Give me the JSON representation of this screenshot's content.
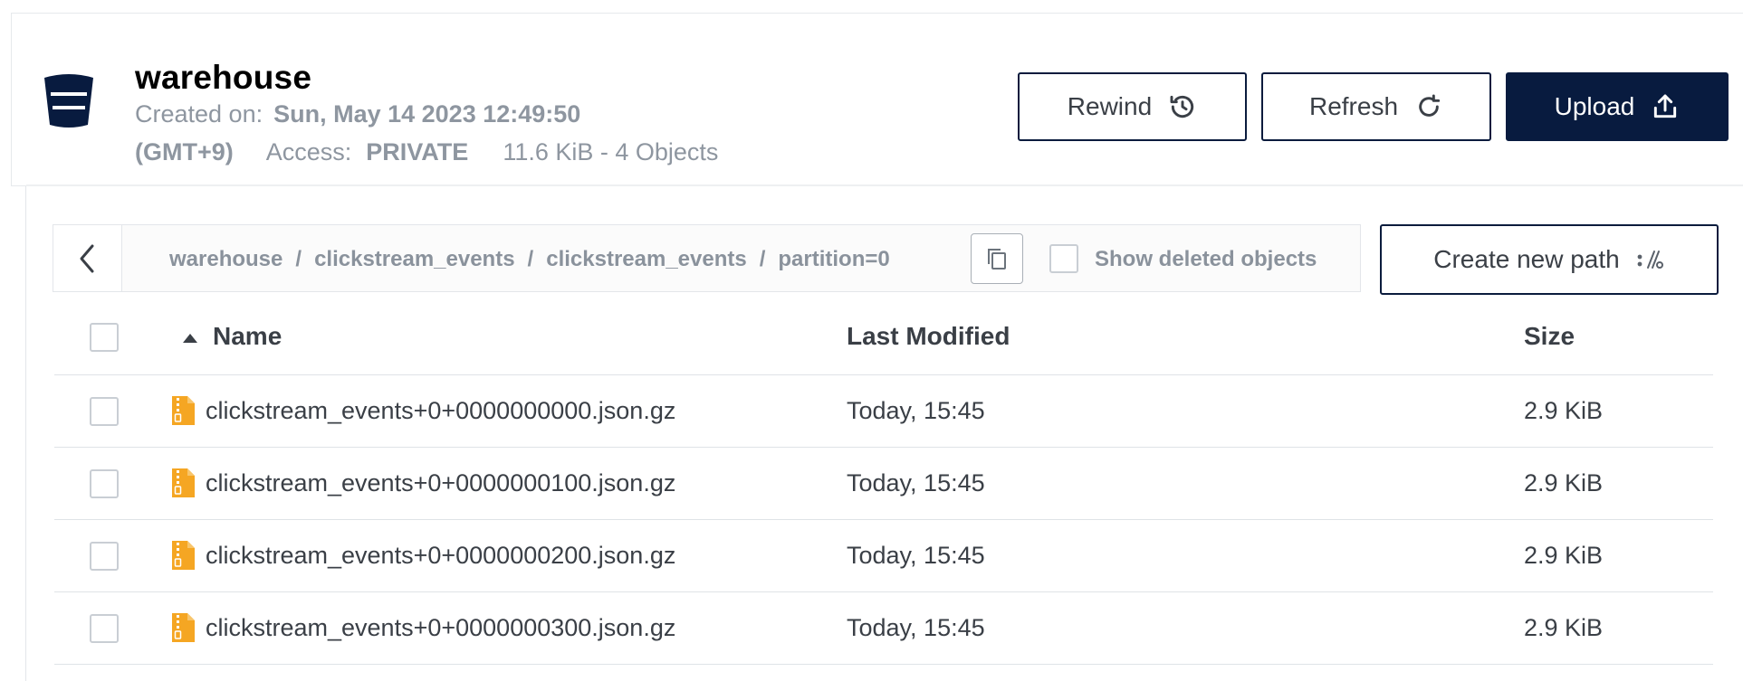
{
  "bucket": {
    "name": "warehouse",
    "created_label": "Created on:",
    "created_value": "Sun, May 14 2023 12:49:50",
    "timezone": "(GMT+9)",
    "access_label": "Access:",
    "access_value": "PRIVATE",
    "usage": "11.6 KiB - 4 Objects"
  },
  "actions": {
    "rewind_label": "Rewind",
    "refresh_label": "Refresh",
    "upload_label": "Upload"
  },
  "breadcrumb": {
    "parts": [
      "warehouse",
      "clickstream_events",
      "clickstream_events",
      "partition=0"
    ],
    "separator": "/"
  },
  "filters": {
    "show_deleted_label": "Show deleted objects"
  },
  "new_path": {
    "label": "Create new path"
  },
  "table": {
    "columns": {
      "name": "Name",
      "modified": "Last Modified",
      "size": "Size"
    },
    "rows": [
      {
        "name": "clickstream_events+0+0000000000.json.gz",
        "modified": "Today, 15:45",
        "size": "2.9 KiB"
      },
      {
        "name": "clickstream_events+0+0000000100.json.gz",
        "modified": "Today, 15:45",
        "size": "2.9 KiB"
      },
      {
        "name": "clickstream_events+0+0000000200.json.gz",
        "modified": "Today, 15:45",
        "size": "2.9 KiB"
      },
      {
        "name": "clickstream_events+0+0000000300.json.gz",
        "modified": "Today, 15:45",
        "size": "2.9 KiB"
      }
    ]
  },
  "colors": {
    "navy": "#081b3f",
    "muted_text": "#8e96a0",
    "body_text": "#3a3f46",
    "file_icon": "#f5a623"
  },
  "icons": {
    "bucket": "bucket-icon",
    "rewind": "history-icon",
    "refresh": "refresh-icon",
    "upload": "upload-icon",
    "back": "chevron-left-icon",
    "copy": "copy-icon",
    "new_path": "path-icon",
    "sort": "sort-asc-icon",
    "file": "zip-file-icon"
  }
}
